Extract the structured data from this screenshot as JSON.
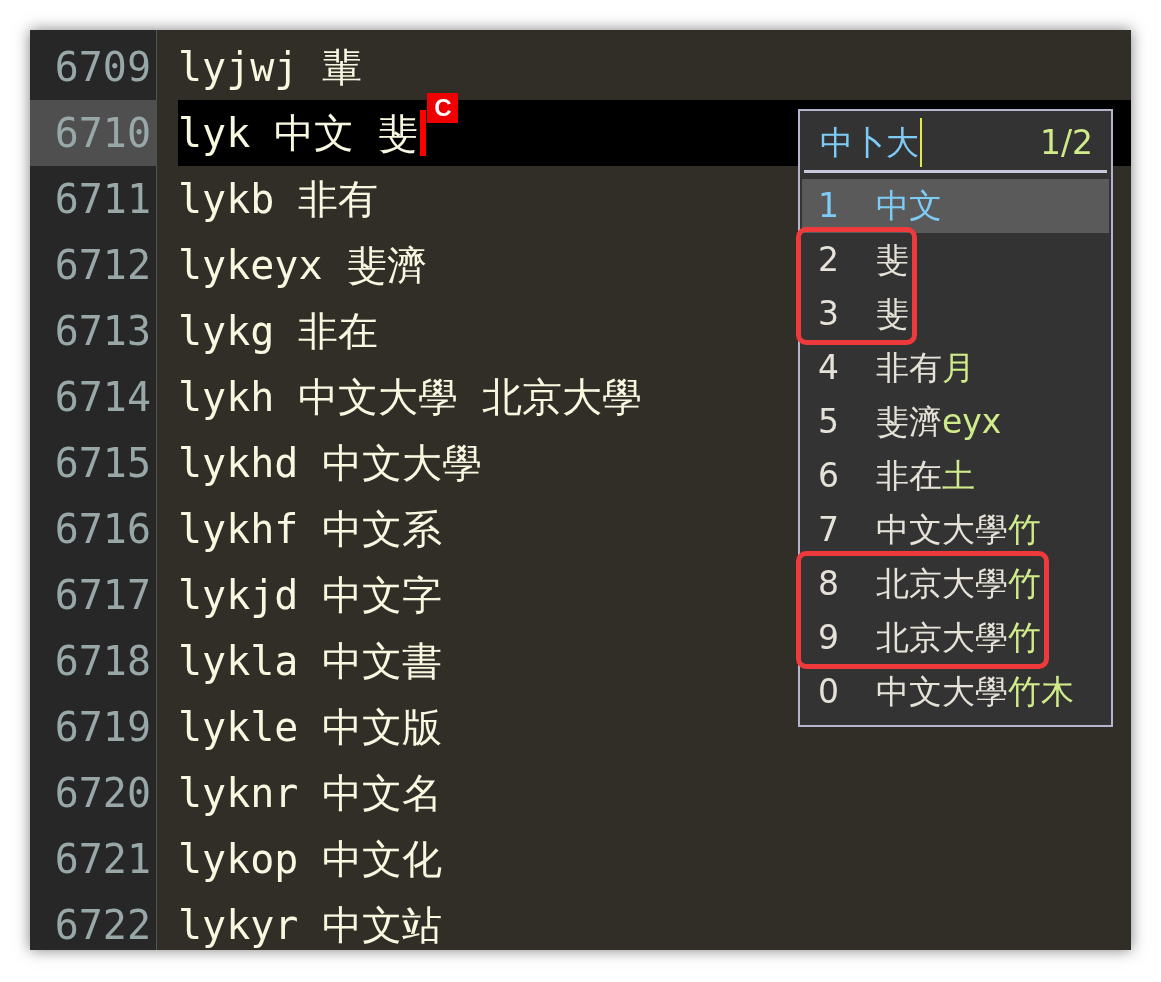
{
  "editor": {
    "lines": [
      {
        "number": "6709",
        "text": "lyjwj 輩",
        "current": false
      },
      {
        "number": "6710",
        "text": "lyk 中文 斐",
        "current": true
      },
      {
        "number": "6711",
        "text": "lykb 非有",
        "current": false
      },
      {
        "number": "6712",
        "text": "lykeyx 斐濟",
        "current": false
      },
      {
        "number": "6713",
        "text": "lykg 非在",
        "current": false
      },
      {
        "number": "6714",
        "text": "lykh 中文大學 北京大學",
        "current": false
      },
      {
        "number": "6715",
        "text": "lykhd 中文大學",
        "current": false
      },
      {
        "number": "6716",
        "text": "lykhf 中文系",
        "current": false
      },
      {
        "number": "6717",
        "text": "lykjd 中文字",
        "current": false
      },
      {
        "number": "6718",
        "text": "lykla 中文書",
        "current": false
      },
      {
        "number": "6719",
        "text": "lykle 中文版",
        "current": false
      },
      {
        "number": "6720",
        "text": "lyknr 中文名",
        "current": false
      },
      {
        "number": "6721",
        "text": "lykop 中文化",
        "current": false
      },
      {
        "number": "6722",
        "text": "lykyr 中文站",
        "current": false
      }
    ],
    "cursor_badge": "C"
  },
  "ime": {
    "composition": "中卜大",
    "page": "1/2",
    "candidates": [
      {
        "index": "1",
        "text": "中文",
        "selected": true,
        "boxed": false
      },
      {
        "index": "2",
        "text": "斐",
        "selected": false,
        "boxed": true
      },
      {
        "index": "3",
        "text": "斐",
        "selected": false,
        "boxed": true
      },
      {
        "index": "4",
        "text": "非有",
        "hint": "月",
        "selected": false,
        "boxed": false
      },
      {
        "index": "5",
        "text": "斐濟",
        "hint": "eyx",
        "selected": false,
        "boxed": false
      },
      {
        "index": "6",
        "text": "非在",
        "hint": "土",
        "selected": false,
        "boxed": false
      },
      {
        "index": "7",
        "text": "中文大學",
        "hint": "竹",
        "selected": false,
        "boxed": false
      },
      {
        "index": "8",
        "text": "北京大學",
        "hint": "竹",
        "selected": false,
        "boxed": true
      },
      {
        "index": "9",
        "text": "北京大學",
        "hint": "竹",
        "selected": false,
        "boxed": true
      },
      {
        "index": "0",
        "text": "中文大學",
        "hint": "竹木",
        "selected": false,
        "boxed": false
      }
    ]
  }
}
